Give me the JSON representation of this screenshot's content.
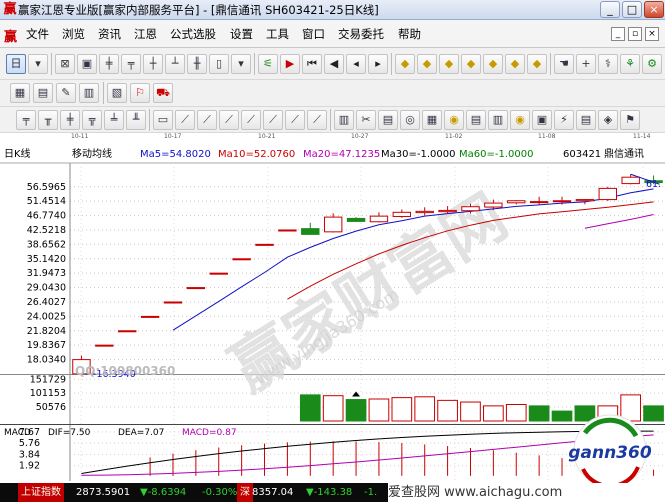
{
  "window": {
    "title": "赢家江恩专业版[赢家内部服务平台] - [鼎信通讯  SH603421-25日K线]",
    "minimize": "_",
    "maximize": "□",
    "close": "×"
  },
  "menu": {
    "items": [
      "文件",
      "浏览",
      "资讯",
      "江恩",
      "公式选股",
      "设置",
      "工具",
      "窗口",
      "交易委托",
      "帮助"
    ],
    "mdi": [
      "_",
      "▫",
      "×"
    ]
  },
  "toolbar1": {
    "tools": [
      {
        "glyph": "日",
        "icon": "period-select-icon"
      },
      {
        "glyph": "▾",
        "icon": "dropdown-icon"
      },
      {
        "glyph": "⊠",
        "icon": "stock-list-icon"
      },
      {
        "glyph": "▣",
        "icon": "quote-table-icon"
      },
      {
        "glyph": "╪",
        "icon": "candle-icon"
      },
      {
        "glyph": "╤",
        "icon": "candle-icon"
      },
      {
        "glyph": "┼",
        "icon": "candle-icon"
      },
      {
        "glyph": "┴",
        "icon": "candle-icon"
      },
      {
        "glyph": "╫",
        "icon": "candle-icon"
      },
      {
        "glyph": "▯",
        "icon": "single-candle-icon"
      },
      {
        "glyph": "▾",
        "icon": "dropdown-icon"
      },
      {
        "glyph": "⚟",
        "icon": "gann-tool-icon"
      },
      {
        "glyph": "▶",
        "icon": "flag-icon"
      },
      {
        "glyph": "⏮",
        "icon": "first-icon"
      },
      {
        "glyph": "◀",
        "icon": "left-icon"
      },
      {
        "glyph": "◂",
        "icon": "step-left-icon"
      },
      {
        "glyph": "▸",
        "icon": "step-right-icon"
      },
      {
        "glyph": "◆",
        "icon": "diamond-icon"
      },
      {
        "glyph": "◆",
        "icon": "diamond-icon"
      },
      {
        "glyph": "◆",
        "icon": "diamond-icon"
      },
      {
        "glyph": "◆",
        "icon": "diamond-icon"
      },
      {
        "glyph": "◆",
        "icon": "diamond-icon"
      },
      {
        "glyph": "◆",
        "icon": "diamond-icon"
      },
      {
        "glyph": "◆",
        "icon": "diamond-icon"
      },
      {
        "glyph": "☚",
        "icon": "hand-icon"
      },
      {
        "glyph": "+",
        "icon": "crosshair-icon"
      },
      {
        "glyph": "⚕",
        "icon": "draw-icon"
      },
      {
        "glyph": "⚘",
        "icon": "gann-fan-icon"
      },
      {
        "glyph": "⚙",
        "icon": "settings-icon"
      }
    ]
  },
  "toolbar2": {
    "tools": [
      {
        "glyph": "▦",
        "icon": "calendar-icon"
      },
      {
        "glyph": "▤",
        "icon": "report-icon"
      },
      {
        "glyph": "✎",
        "icon": "edit-icon"
      },
      {
        "glyph": "▥",
        "icon": "grid-icon"
      },
      {
        "glyph": "▧",
        "icon": "table-icon"
      },
      {
        "glyph": "⚐",
        "icon": "marker-icon"
      },
      {
        "glyph": "⛟",
        "icon": "truck-icon"
      }
    ]
  },
  "toolbar3": {
    "tools": [
      {
        "glyph": "╤",
        "icon": "line-tool-icon"
      },
      {
        "glyph": "╥",
        "icon": "line-tool-icon"
      },
      {
        "glyph": "╪",
        "icon": "line-tool-icon"
      },
      {
        "glyph": "╦",
        "icon": "line-tool-icon"
      },
      {
        "glyph": "╧",
        "icon": "line-tool-icon"
      },
      {
        "glyph": "╨",
        "icon": "line-tool-icon"
      },
      {
        "glyph": "▭",
        "icon": "rect-tool-icon"
      },
      {
        "glyph": "⟋",
        "icon": "angle-tool-icon"
      },
      {
        "glyph": "⟋",
        "icon": "angle-tool-icon"
      },
      {
        "glyph": "⟋",
        "icon": "angle-tool-icon"
      },
      {
        "glyph": "⟋",
        "icon": "angle-tool-icon"
      },
      {
        "glyph": "⟋",
        "icon": "angle-tool-icon"
      },
      {
        "glyph": "⟋",
        "icon": "angle-tool-icon"
      },
      {
        "glyph": "⟋",
        "icon": "angle-tool-icon"
      },
      {
        "glyph": "▥",
        "icon": "bar-tool-icon"
      },
      {
        "glyph": "✂",
        "icon": "cut-icon"
      },
      {
        "glyph": "▤",
        "icon": "list-tool-icon"
      },
      {
        "glyph": "◎",
        "icon": "circle-tool-icon"
      },
      {
        "glyph": "▦",
        "icon": "grid-tool-icon"
      },
      {
        "glyph": "◉",
        "icon": "gold-icon"
      },
      {
        "glyph": "▤",
        "icon": "list-tool-icon"
      },
      {
        "glyph": "▥",
        "icon": "bar-tool-icon"
      },
      {
        "glyph": "◉",
        "icon": "gold-icon"
      },
      {
        "glyph": "▣",
        "icon": "box-tool-icon"
      },
      {
        "glyph": "⚡",
        "icon": "signal-icon"
      },
      {
        "glyph": "▤",
        "icon": "list-tool-icon"
      },
      {
        "glyph": "◈",
        "icon": "gann-box-icon"
      },
      {
        "glyph": "⚑",
        "icon": "flag-tool-icon"
      }
    ]
  },
  "dates": [
    "10-11",
    "10-17",
    "10-21",
    "10-27",
    "11-02",
    "11-08",
    "11-14"
  ],
  "chart_data": {
    "type": "candlestick",
    "chart_label": "日K线",
    "indicator_name": "移动均线",
    "stock": {
      "code": "603421",
      "name": "鼎信通讯"
    },
    "ma_labels": [
      {
        "text": "Ma5=54.8020",
        "color": "#1010c8"
      },
      {
        "text": "Ma10=52.0760",
        "color": "#c80000"
      },
      {
        "text": "Ma20=47.1235",
        "color": "#b000b0"
      },
      {
        "text": "Ma30=-1.0000",
        "color": "#000000"
      },
      {
        "text": "Ma60=-1.0000",
        "color": "#008000"
      }
    ],
    "price_ticks": [
      "56.5965",
      "51.4514",
      "46.7740",
      "42.5218",
      "38.6562",
      "35.1420",
      "31.9473",
      "29.0430",
      "26.4027",
      "24.0025",
      "21.8204",
      "19.8367",
      "18.0340"
    ],
    "price_axis_values": [
      56.5965,
      51.4514,
      46.774,
      42.5218,
      38.6562,
      35.142,
      31.9473,
      29.043,
      26.4027,
      24.0025,
      21.8204,
      19.8367,
      18.034
    ],
    "ylim_price": [
      16.5,
      62
    ],
    "log_scale": true,
    "low_annotation": "16.3940",
    "high_annotation": "61.",
    "candles": [
      {
        "o": 16.4,
        "h": 18.5,
        "l": 16.39,
        "c": 18.03,
        "color": "red"
      },
      {
        "o": 19.84,
        "h": 19.84,
        "l": 19.84,
        "c": 19.84,
        "color": "red"
      },
      {
        "o": 21.82,
        "h": 21.82,
        "l": 21.82,
        "c": 21.82,
        "color": "red"
      },
      {
        "o": 24.0,
        "h": 24.0,
        "l": 24.0,
        "c": 24.0,
        "color": "red"
      },
      {
        "o": 26.4,
        "h": 26.4,
        "l": 26.4,
        "c": 26.4,
        "color": "red"
      },
      {
        "o": 29.04,
        "h": 29.04,
        "l": 29.04,
        "c": 29.04,
        "color": "red"
      },
      {
        "o": 31.95,
        "h": 31.95,
        "l": 31.95,
        "c": 31.95,
        "color": "red"
      },
      {
        "o": 35.14,
        "h": 35.14,
        "l": 35.14,
        "c": 35.14,
        "color": "red"
      },
      {
        "o": 38.66,
        "h": 38.66,
        "l": 38.66,
        "c": 38.66,
        "color": "red"
      },
      {
        "o": 42.52,
        "h": 42.52,
        "l": 42.52,
        "c": 42.52,
        "color": "red"
      },
      {
        "o": 42.9,
        "h": 44.6,
        "l": 41.3,
        "c": 41.3,
        "color": "green"
      },
      {
        "o": 42.0,
        "h": 47.5,
        "l": 41.8,
        "c": 46.3,
        "color": "red"
      },
      {
        "o": 45.9,
        "h": 46.3,
        "l": 44.9,
        "c": 45.0,
        "color": "green"
      },
      {
        "o": 44.9,
        "h": 47.8,
        "l": 44.7,
        "c": 46.6,
        "color": "red"
      },
      {
        "o": 46.5,
        "h": 48.7,
        "l": 46.1,
        "c": 47.8,
        "color": "red"
      },
      {
        "o": 47.7,
        "h": 49.4,
        "l": 46.8,
        "c": 48.1,
        "color": "red"
      },
      {
        "o": 48.0,
        "h": 49.8,
        "l": 47.3,
        "c": 48.4,
        "color": "red"
      },
      {
        "o": 48.3,
        "h": 50.6,
        "l": 47.4,
        "c": 49.6,
        "color": "red"
      },
      {
        "o": 49.5,
        "h": 52.0,
        "l": 48.5,
        "c": 50.8,
        "color": "red"
      },
      {
        "o": 50.9,
        "h": 51.8,
        "l": 50.4,
        "c": 51.6,
        "color": "red"
      },
      {
        "o": 51.0,
        "h": 53.0,
        "l": 50.2,
        "c": 51.3,
        "color": "red"
      },
      {
        "o": 51.3,
        "h": 53.0,
        "l": 50.3,
        "c": 51.6,
        "color": "red"
      },
      {
        "o": 51.6,
        "h": 52.2,
        "l": 50.4,
        "c": 52.0,
        "color": "red"
      },
      {
        "o": 52.0,
        "h": 56.6,
        "l": 51.5,
        "c": 56.0,
        "color": "red"
      },
      {
        "o": 57.8,
        "h": 61.5,
        "l": 57.5,
        "c": 60.3,
        "color": "red"
      },
      {
        "o": 58.9,
        "h": 61.0,
        "l": 57.6,
        "c": 58.2,
        "color": "green"
      }
    ],
    "ma5": [
      null,
      null,
      null,
      null,
      21.9,
      24.1,
      26.5,
      29.2,
      32.1,
      35.5,
      37.9,
      40.2,
      42.2,
      44.0,
      45.2,
      46.6,
      47.4,
      48.1,
      48.9,
      49.7,
      50.2,
      50.8,
      51.2,
      52.5,
      54.4,
      55.8
    ],
    "ma10": [
      null,
      null,
      null,
      null,
      null,
      null,
      null,
      null,
      null,
      26.9,
      29.3,
      31.7,
      34.0,
      36.3,
      38.4,
      40.4,
      42.3,
      43.9,
      45.3,
      46.3,
      47.3,
      48.0,
      48.7,
      49.4,
      50.3,
      51.2
    ],
    "ma20": [
      null,
      null,
      null,
      null,
      null,
      null,
      null,
      null,
      null,
      null,
      null,
      null,
      null,
      null,
      null,
      null,
      null,
      null,
      null,
      null,
      null,
      null,
      43.0,
      44.3,
      45.6,
      47.1
    ],
    "volume": {
      "ticks": [
        "151729",
        "101153",
        "50576"
      ],
      "values": [
        0,
        0,
        0,
        0,
        0,
        0,
        0,
        0,
        0,
        0,
        95000,
        92000,
        78000,
        80000,
        85000,
        88000,
        75000,
        69000,
        55000,
        60000,
        55000,
        36000,
        55000,
        55000,
        95000,
        55000
      ],
      "colors": [
        "red",
        "red",
        "red",
        "red",
        "red",
        "red",
        "red",
        "red",
        "red",
        "red",
        "green",
        "red",
        "green",
        "red",
        "red",
        "red",
        "red",
        "red",
        "red",
        "red",
        "green",
        "green",
        "green",
        "red",
        "red",
        "green"
      ],
      "ymax": 160000
    },
    "macd": {
      "label": "MACD",
      "dif_label": "DIF=7.50",
      "dea_label": "DEA=7.07",
      "macd_label": "MACD=0.87",
      "ticks": [
        "7.67",
        "5.76",
        "3.84",
        "1.92"
      ],
      "ylim": [
        0,
        8.5
      ]
    }
  },
  "watermarks": {
    "qq": "QQ:100800360"
  },
  "statusbar": {
    "index_name": "上证指数",
    "index_value": "2873.5901",
    "index_change": "▼-8.6394",
    "index_pct": "-0.30%",
    "deep_name": "深",
    "deep_value": "8357.04",
    "deep_change": "▼-143.38",
    "deep_pct": "-1."
  },
  "footer": {
    "text": "爱查股网 www.aichagu.com"
  }
}
